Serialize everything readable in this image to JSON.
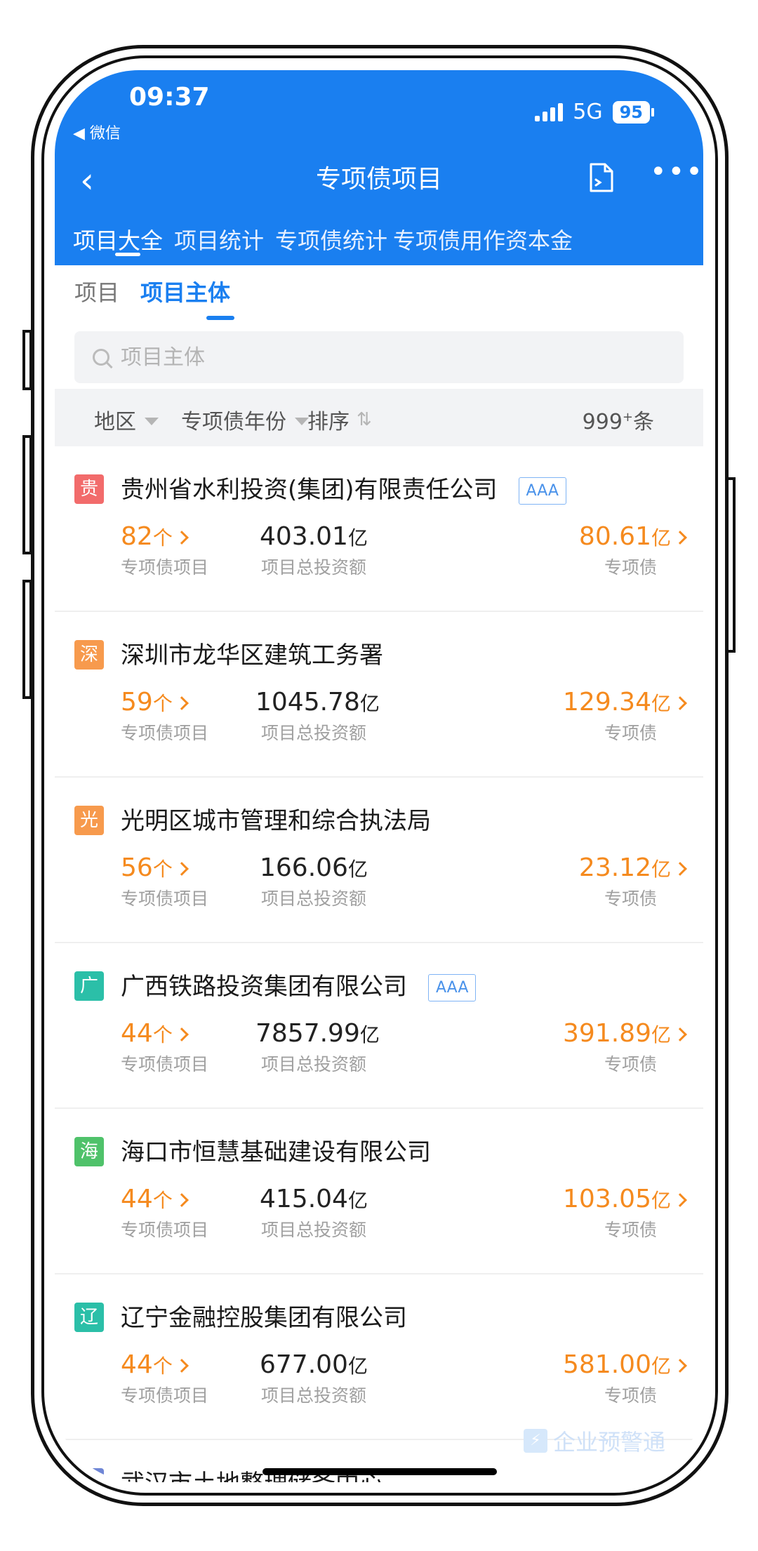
{
  "status": {
    "time": "09:37",
    "back_label": "◀ 微信",
    "network": "5G",
    "battery": "95"
  },
  "nav": {
    "title": "专项债项目",
    "back_icon": "chevron-left-icon",
    "more": "•••"
  },
  "top_tabs": [
    "项目大全",
    "项目统计",
    "专项债统计",
    "专项债用作资本金"
  ],
  "sub_tabs": [
    "项目",
    "项目主体"
  ],
  "search": {
    "placeholder": "项目主体"
  },
  "filters": {
    "region": "地区",
    "year": "专项债年份",
    "sort": "排序",
    "count": "999",
    "count_sup": "+",
    "count_unit": "条"
  },
  "labels": {
    "projects": "专项债项目",
    "investment": "项目总投资额",
    "bonds": "专项债",
    "count_unit": "个",
    "money_unit": "亿"
  },
  "colors": {
    "brand_blue": "#1a7ff0",
    "accent_orange": "#f58a1e"
  },
  "items": [
    {
      "badge": "贵",
      "badge_color": "#f26b6b",
      "name": "贵州省水利投资(集团)有限责任公司",
      "rating": "AAA",
      "projects": "82",
      "investment": "403.01",
      "bonds": "80.61"
    },
    {
      "badge": "深",
      "badge_color": "#f79a4d",
      "name": "深圳市龙华区建筑工务署",
      "rating": "",
      "projects": "59",
      "investment": "1045.78",
      "bonds": "129.34"
    },
    {
      "badge": "光",
      "badge_color": "#f79a4d",
      "name": "光明区城市管理和综合执法局",
      "rating": "",
      "projects": "56",
      "investment": "166.06",
      "bonds": "23.12"
    },
    {
      "badge": "广",
      "badge_color": "#2bbfa8",
      "name": "广西铁路投资集团有限公司",
      "rating": "AAA",
      "projects": "44",
      "investment": "7857.99",
      "bonds": "391.89"
    },
    {
      "badge": "海",
      "badge_color": "#4fc26a",
      "name": "海口市恒慧基础建设有限公司",
      "rating": "",
      "projects": "44",
      "investment": "415.04",
      "bonds": "103.05"
    },
    {
      "badge": "辽",
      "badge_color": "#2bbfa8",
      "name": "辽宁金融控股集团有限公司",
      "rating": "",
      "projects": "44",
      "investment": "677.00",
      "bonds": "581.00"
    },
    {
      "badge": "",
      "badge_color": "#6f86d6",
      "name": "武汉市土地整理储备中心",
      "rating": "",
      "projects": "",
      "investment": "",
      "bonds": ""
    }
  ],
  "watermark": "企业预警通"
}
